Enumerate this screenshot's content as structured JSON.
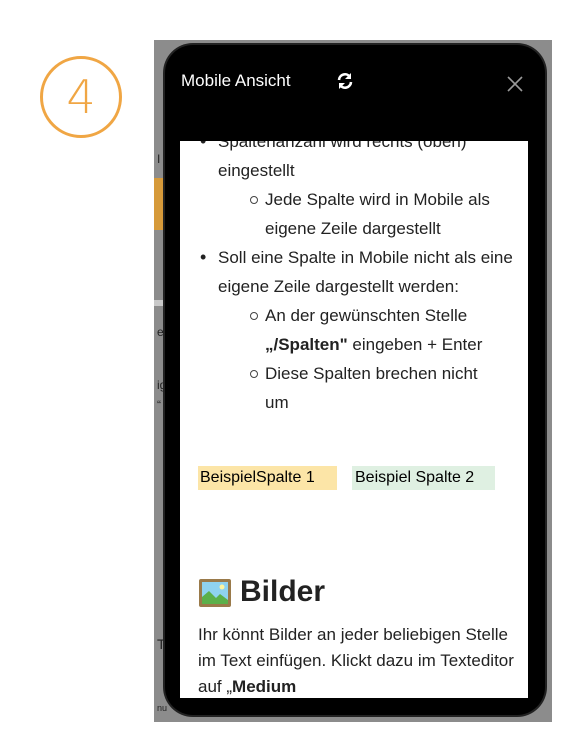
{
  "step": {
    "number": "4"
  },
  "background": {
    "fragments": [
      "I",
      "e",
      "ig",
      "“",
      "T",
      "nu"
    ]
  },
  "mobile_preview": {
    "title": "Mobile Ansicht",
    "icons": {
      "refresh": "refresh-icon",
      "close": "close-icon",
      "heading_image": "image-icon"
    },
    "list": [
      {
        "text": "Spaltenanzahl wird rechts (oben) eingestellt",
        "children": [
          "Jede Spalte wird in Mobile als eigene Zeile dargestellt"
        ]
      },
      {
        "text": "Soll eine Spalte in Mobile nicht als eine eigene Zeile dargestellt werden:",
        "children_rich": [
          {
            "before": "An der gewünschten Stelle ",
            "bold": "„/Spalten\"",
            "after": " eingeben + Enter"
          }
        ],
        "children": [
          "Diese Spalten brechen nicht um"
        ]
      }
    ],
    "columns": [
      "BeispielSpalte 1",
      "Beispiel Spalte 2"
    ],
    "column_colors": {
      "col1": "#fce5a7",
      "col2": "#dff0e2"
    },
    "heading": "Bilder",
    "paragraph": {
      "before": "Ihr könnt Bilder an jeder beliebigen Stelle im Text einfügen. Klickt dazu im Texteditor auf „",
      "bold": "Medium"
    }
  },
  "colors": {
    "badge": "#f0a644",
    "frame": "#000000"
  }
}
